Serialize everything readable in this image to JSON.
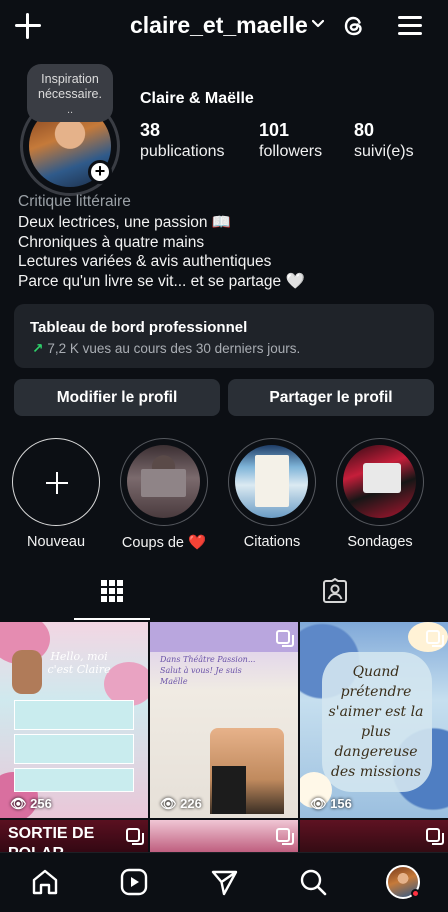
{
  "header": {
    "username": "claire_et_maelle"
  },
  "profile": {
    "note": "Inspiration nécessaire.",
    "note_suffix": "..",
    "display_name": "Claire & Maëlle",
    "stats": [
      {
        "value": "38",
        "label": "publications"
      },
      {
        "value": "101",
        "label": "followers"
      },
      {
        "value": "80",
        "label": "suivi(e)s"
      }
    ],
    "category": "Critique littéraire",
    "bio": [
      "Deux lectrices, une passion 📖",
      "Chroniques à quatre mains",
      "Lectures variées & avis authentiques",
      "Parce qu'un livre se vit... et se partage 🤍"
    ]
  },
  "dashboard": {
    "title": "Tableau de bord professionnel",
    "subtitle": "7,2 K vues au cours des 30 derniers jours."
  },
  "buttons": {
    "edit": "Modifier le profil",
    "share": "Partager le profil"
  },
  "highlights": [
    {
      "label": "Nouveau"
    },
    {
      "label": "Coups de ❤️"
    },
    {
      "label": "Citations"
    },
    {
      "label": "Sondages"
    }
  ],
  "posts": [
    {
      "views": "256",
      "title": "Hello, moi c'est Claire"
    },
    {
      "views": "226",
      "title": "Dans Théâtre Passion... Salut à vous! Je suis Maëlle"
    },
    {
      "views": "156",
      "quote": "Quand prétendre s'aimer est la plus dangereuse des missions"
    },
    {
      "title": "SORTIE DE POLAR"
    }
  ],
  "colors": {
    "background": "#0c0f14",
    "card": "#1f2329",
    "button": "#2a2f36",
    "trend": "#2fd36b",
    "muted": "#9aa0a6"
  },
  "icons": {
    "top": [
      "plus-icon",
      "chevron-down-icon",
      "threads-icon",
      "hamburger-menu-icon"
    ],
    "tabs": [
      "grid-icon",
      "tagged-icon"
    ],
    "nav": [
      "home-icon",
      "reels-icon",
      "send-icon",
      "search-icon",
      "profile-avatar"
    ]
  }
}
